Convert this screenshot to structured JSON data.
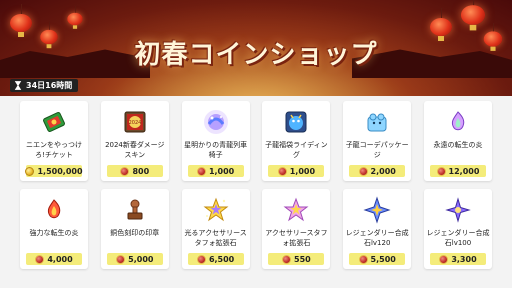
{
  "header": {
    "title": "初春コインショップ",
    "timer": "34日16時間"
  },
  "items": [
    {
      "name": "ニエンをやっつけろ!チケット",
      "price": "1,500,000",
      "currency": "gold-coin",
      "icon": "red-ticket-icon"
    },
    {
      "name": "2024新春ダメージスキン",
      "price": "800",
      "currency": "red-coin",
      "icon": "damage-skin-icon"
    },
    {
      "name": "星明かりの青龍列車椅子",
      "price": "1,000",
      "currency": "red-coin",
      "icon": "dragon-chair-icon"
    },
    {
      "name": "子龍福袋ライディング",
      "price": "1,000",
      "currency": "red-coin",
      "icon": "dragon-mount-icon"
    },
    {
      "name": "子龍コーデパッケージ",
      "price": "2,000",
      "currency": "red-coin",
      "icon": "dragon-package-icon"
    },
    {
      "name": "永遠の転生の炎",
      "price": "12,000",
      "currency": "red-coin",
      "icon": "eternal-flame-icon"
    },
    {
      "name": "強力な転生の炎",
      "price": "4,000",
      "currency": "red-coin",
      "icon": "powerful-flame-icon"
    },
    {
      "name": "銅色刻印の印章",
      "price": "5,000",
      "currency": "red-coin",
      "icon": "bronze-stamp-icon"
    },
    {
      "name": "光るアクセサリースタフォ拡張石",
      "price": "6,500",
      "currency": "red-coin",
      "icon": "shining-star-stone-icon"
    },
    {
      "name": "アクセサリースタフォ拡張石",
      "price": "550",
      "currency": "red-coin",
      "icon": "star-stone-icon"
    },
    {
      "name": "レジェンダリー合成石lv120",
      "price": "5,500",
      "currency": "red-coin",
      "icon": "legendary-stone-120-icon"
    },
    {
      "name": "レジェンダリー合成石lv100",
      "price": "3,300",
      "currency": "red-coin",
      "icon": "legendary-stone-100-icon"
    }
  ],
  "colors": {
    "price_bg": "#f4ec7a",
    "banner_red": "#8a2a13",
    "red_coin": "#c0302a",
    "gold_coin": "#e9b928"
  }
}
